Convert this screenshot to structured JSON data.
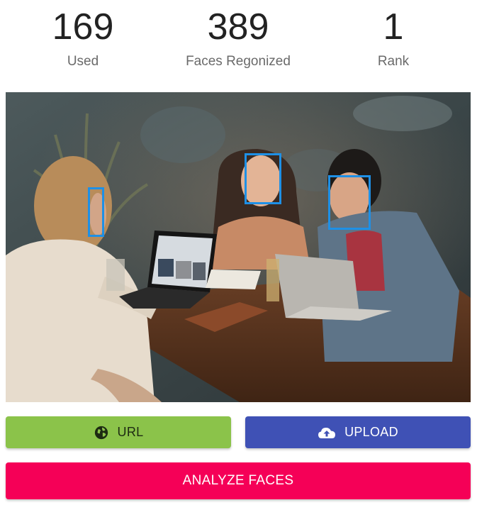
{
  "stats": {
    "used": {
      "value": "169",
      "label": "Used"
    },
    "faces": {
      "value": "389",
      "label": "Faces Regonized"
    },
    "rank": {
      "value": "1",
      "label": "Rank"
    }
  },
  "photo": {
    "face_box_count": 3,
    "face_box_color": "#1e90e6"
  },
  "buttons": {
    "url": {
      "label": "URL",
      "icon": "globe-icon",
      "color": "#8bc34a"
    },
    "upload": {
      "label": "UPLOAD",
      "icon": "cloud-upload-icon",
      "color": "#3f51b5"
    },
    "analyze": {
      "label": "ANALYZE FACES",
      "color": "#f50057"
    }
  }
}
